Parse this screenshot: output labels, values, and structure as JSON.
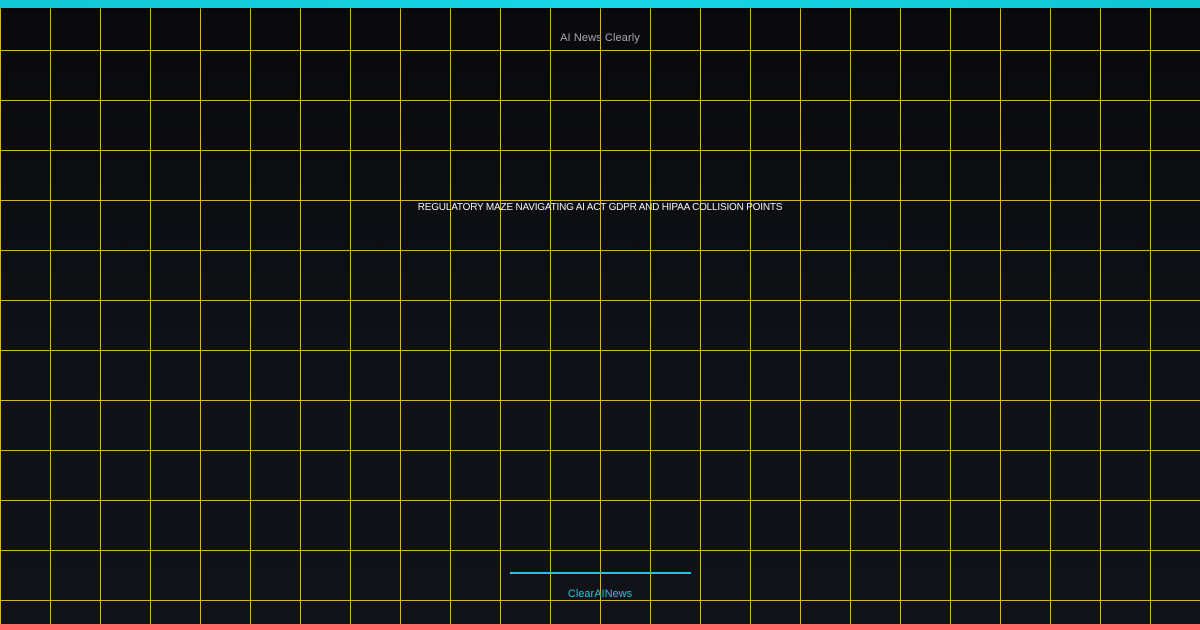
{
  "brand": {
    "top_label": "AI News Clearly",
    "bottom_label": "ClearAINews"
  },
  "headline": {
    "text": "REGULATORY MAZE NAVIGATING AI ACT GDPR AND HIPAA COLLISION POINTS"
  },
  "colors": {
    "accent_top": "#18d7e6",
    "accent_bottom": "#ff6b6b",
    "grid": "#e7c639",
    "background": "#0f1117",
    "bottom_brand": "#27c3d8"
  }
}
